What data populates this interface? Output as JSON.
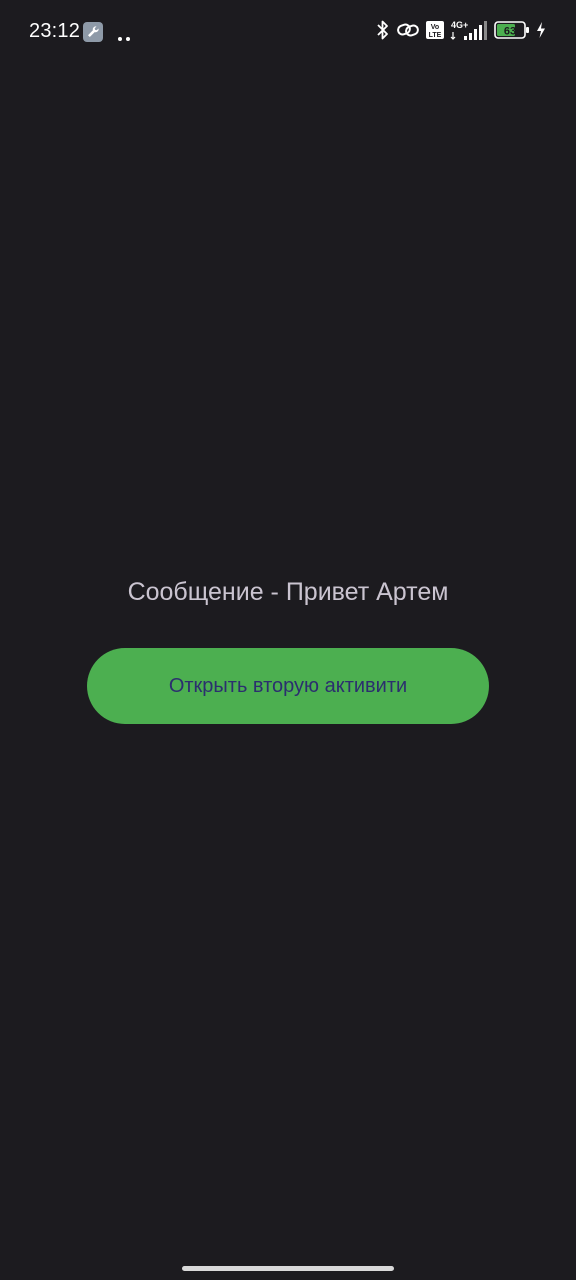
{
  "status_bar": {
    "time": "23:12",
    "network": "4G+",
    "volte": "Vo LTE",
    "battery_level": "63",
    "icons": [
      "wrench-icon",
      "dots-icon",
      "bluetooth-icon",
      "link-icon",
      "volte-icon",
      "signal-icon",
      "battery-icon",
      "charging-icon"
    ]
  },
  "main": {
    "message": "Сообщение - Привет Артем",
    "open_button_label": "Открыть вторую активити"
  },
  "colors": {
    "background": "#1c1b1f",
    "button": "#4caf50",
    "button_text": "#2b2f6e",
    "message_text": "#cac4d0",
    "battery": "#4caf50"
  }
}
